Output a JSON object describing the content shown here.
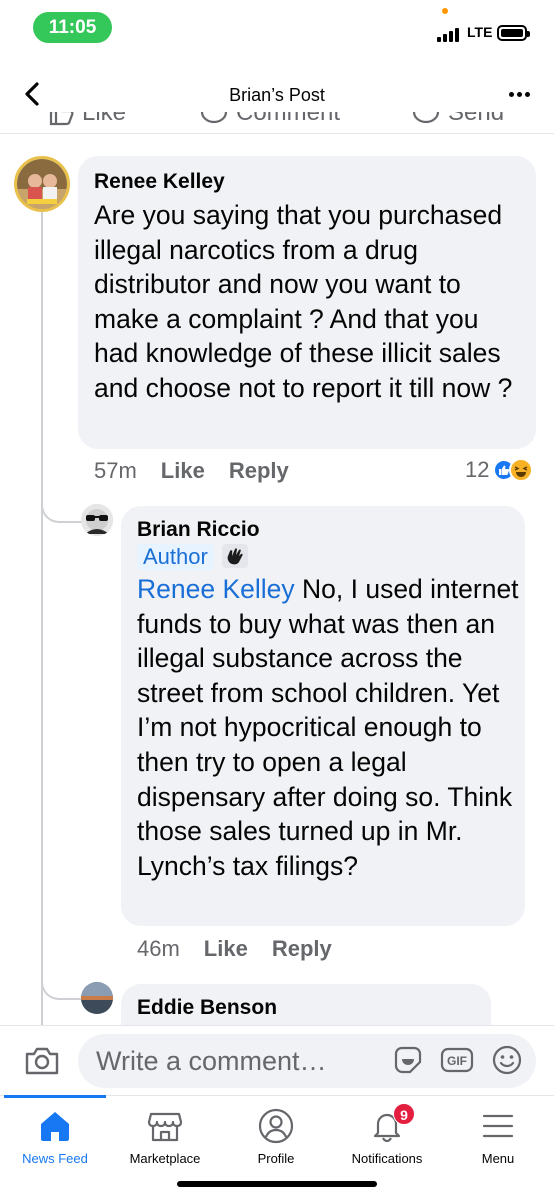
{
  "status_bar": {
    "time": "11:05",
    "network": "LTE"
  },
  "header": {
    "title": "Brian’s Post"
  },
  "post_actions": {
    "like": "Like",
    "comment": "Comment",
    "send": "Send"
  },
  "comments": [
    {
      "author": "Renee Kelley",
      "text": "Are you saying that you purchased illegal narcotics from a drug distributor and now you want to make a complaint ? And that you had knowledge of these illicit sales and choose not to report it till now ?",
      "time": "57m",
      "like_label": "Like",
      "reply_label": "Reply",
      "reaction_count": "12",
      "reaction_icons": [
        "like-reaction",
        "haha-reaction"
      ]
    },
    {
      "author": "Brian Riccio",
      "badge": "Author",
      "badge_icon": "wave-icon",
      "mention": "Renee Kelley",
      "text": " No, I used internet funds to buy what was then an illegal substance across the street from school children. Yet I’m not hypocritical enough to then try to open a legal dispensary after doing so. Think those sales turned up in Mr. Lynch’s tax filings?",
      "time": "46m",
      "like_label": "Like",
      "reply_label": "Reply"
    },
    {
      "author": "Eddie Benson"
    }
  ],
  "composer": {
    "placeholder": "Write a comment…"
  },
  "tabs": [
    {
      "label": "News Feed",
      "icon": "home-icon",
      "active": true
    },
    {
      "label": "Marketplace",
      "icon": "marketplace-icon"
    },
    {
      "label": "Profile",
      "icon": "profile-icon"
    },
    {
      "label": "Notifications",
      "icon": "bell-icon",
      "badge": "9"
    },
    {
      "label": "Menu",
      "icon": "menu-icon"
    }
  ],
  "colors": {
    "accent": "#1877f2",
    "bubble": "#f0f2f5",
    "link": "#1a6fd6",
    "badge": "#e41e3f"
  }
}
